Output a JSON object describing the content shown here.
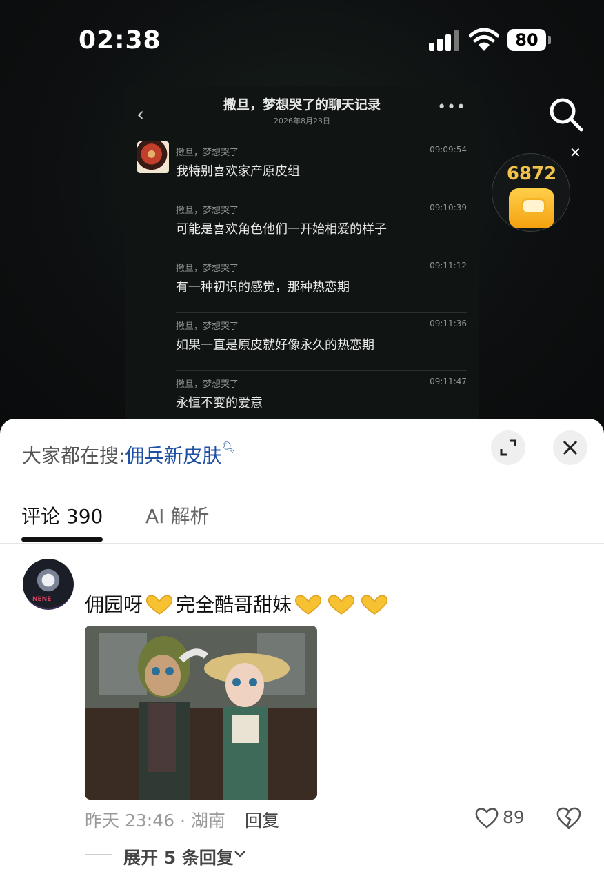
{
  "status": {
    "time": "02:38",
    "battery": "80"
  },
  "chat": {
    "title": "撒旦，梦想哭了的聊天记录",
    "date": "2026年8月23日",
    "messages": [
      {
        "sender": "撒旦，梦想哭了",
        "time": "09:09:54",
        "text": "我特别喜欢家产原皮组"
      },
      {
        "sender": "撒旦，梦想哭了",
        "time": "09:10:39",
        "text": "可能是喜欢角色他们一开始相爱的样子"
      },
      {
        "sender": "撒旦，梦想哭了",
        "time": "09:11:12",
        "text": "有一种初识的感觉，那种热恋期"
      },
      {
        "sender": "撒旦，梦想哭了",
        "time": "09:11:36",
        "text": "如果一直是原皮就好像永久的热恋期"
      },
      {
        "sender": "撒旦，梦想哭了",
        "time": "09:11:47",
        "text": "永恒不变的爱意"
      }
    ]
  },
  "reward": {
    "coins": "6872"
  },
  "sheet": {
    "hot_search_prefix": "大家都在搜:",
    "hot_search_keyword": "佣兵新皮肤",
    "tabs": {
      "comments": "评论 390",
      "ai": "AI 解析"
    }
  },
  "comment": {
    "text_part1": "佣园呀",
    "text_part2": "完全酷哥甜妹",
    "time_location": "昨天 23:46 · 湖南",
    "reply_label": "回复",
    "likes": "89",
    "expand_label": "展开 5 条回复"
  },
  "colors": {
    "link": "#1d4fa3",
    "coin": "#f3c24a"
  }
}
